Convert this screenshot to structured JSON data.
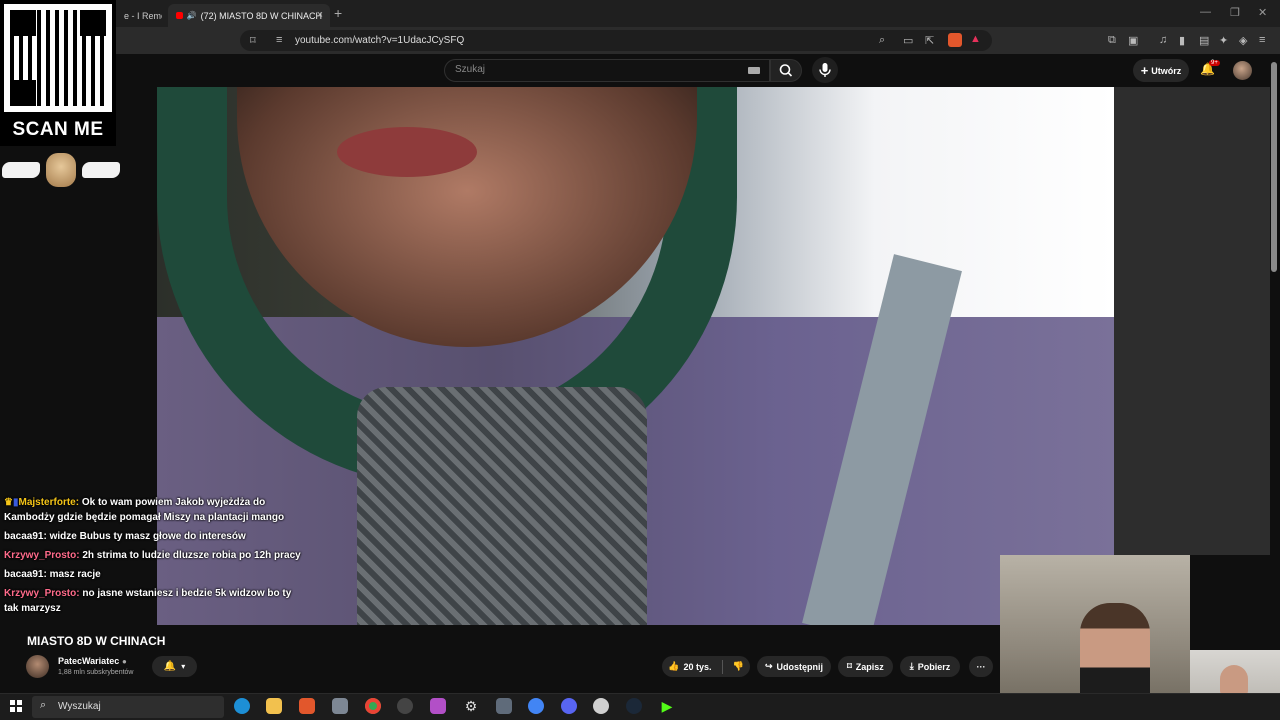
{
  "browser": {
    "tabs": [
      {
        "label": "e - I Remem"
      },
      {
        "label": "(72) MIASTO 8D W CHINACH",
        "active": true
      }
    ],
    "new_tab": "+",
    "close_tab": "×",
    "url": "youtube.com/watch?v=1UdacJCySFQ"
  },
  "youtube": {
    "search_placeholder": "Szukaj",
    "create_label": "Utwórz",
    "notif_badge": "9+"
  },
  "overlay": {
    "scan_label": "SCAN ME",
    "chat": [
      {
        "user": "Majsterforte:",
        "text": " Ok to wam powiem Jakob wyjeżdża do Kambodży gdzie będzie pomagał Miszy na plantacji mango",
        "color": "gold"
      },
      {
        "user": "bacaa91:",
        "text": " widze Bubus ty masz głowe do interesów",
        "color": "white"
      },
      {
        "user": "Krzywy_Prosto:",
        "text": " 2h strima to ludzie dluzsze robia po 12h pracy",
        "color": "pink"
      },
      {
        "user": "bacaa91:",
        "text": " masz racje",
        "color": "white"
      },
      {
        "user": "Krzywy_Prosto:",
        "text": " no jasne wstaniesz i bedzie 5k widzow bo ty tak marzysz",
        "color": "pink"
      }
    ]
  },
  "video": {
    "title": "MIASTO 8D W CHINACH",
    "channel": "PatecWariatec",
    "subscribers": "1,88 mln subskrybentów",
    "likes": "20 tys.",
    "share_label": "Udostępnij",
    "save_label": "Zapisz",
    "download_label": "Pobierz",
    "more_label": "···"
  },
  "taskbar": {
    "search_placeholder": "Wyszukaj"
  },
  "colors": {
    "accent_red": "#ff0000",
    "badge_red": "#cc0000",
    "chat_gold": "#f5c518",
    "chat_pink": "#ff6b8b"
  }
}
